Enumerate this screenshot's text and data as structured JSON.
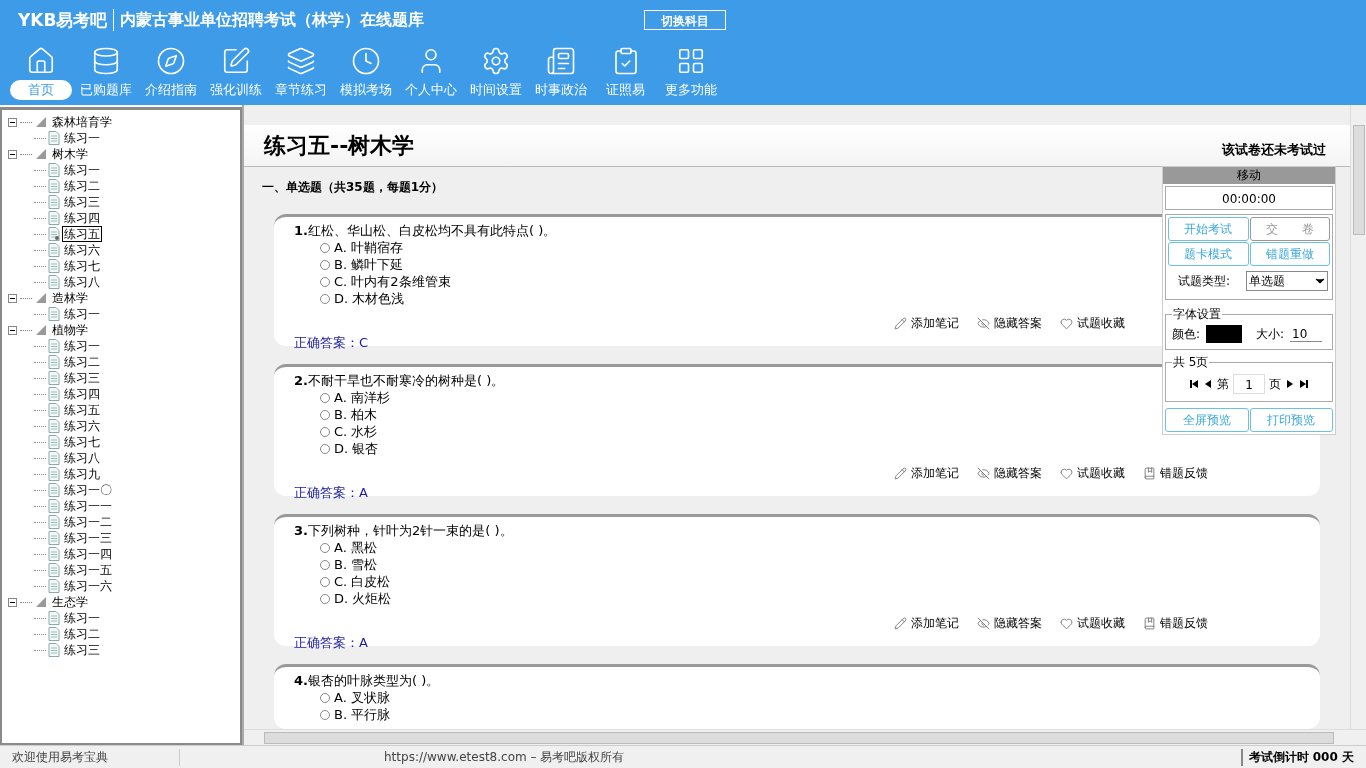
{
  "header": {
    "logo": "YKB易考吧",
    "title": "内蒙古事业单位招聘考试（林学）在线题库",
    "switch_button": "切换科目"
  },
  "nav": [
    {
      "label": "首页",
      "selected": true
    },
    {
      "label": "已购题库",
      "selected": false
    },
    {
      "label": "介绍指南",
      "selected": false
    },
    {
      "label": "强化训练",
      "selected": false
    },
    {
      "label": "章节练习",
      "selected": false
    },
    {
      "label": "模拟考场",
      "selected": false
    },
    {
      "label": "个人中心",
      "selected": false
    },
    {
      "label": "时间设置",
      "selected": false
    },
    {
      "label": "时事政治",
      "selected": false
    },
    {
      "label": "证照易",
      "selected": false
    },
    {
      "label": "更多功能",
      "selected": false
    }
  ],
  "tree": [
    {
      "label": "森林培育学",
      "expanded": true,
      "children": [
        {
          "label": "练习一",
          "selected": false
        }
      ]
    },
    {
      "label": "树木学",
      "expanded": true,
      "children": [
        {
          "label": "练习一",
          "selected": false
        },
        {
          "label": "练习二",
          "selected": false
        },
        {
          "label": "练习三",
          "selected": false
        },
        {
          "label": "练习四",
          "selected": false
        },
        {
          "label": "练习五",
          "selected": true
        },
        {
          "label": "练习六",
          "selected": false
        },
        {
          "label": "练习七",
          "selected": false
        },
        {
          "label": "练习八",
          "selected": false
        }
      ]
    },
    {
      "label": "造林学",
      "expanded": true,
      "children": [
        {
          "label": "练习一",
          "selected": false
        }
      ]
    },
    {
      "label": "植物学",
      "expanded": true,
      "children": [
        {
          "label": "练习一",
          "selected": false
        },
        {
          "label": "练习二",
          "selected": false
        },
        {
          "label": "练习三",
          "selected": false
        },
        {
          "label": "练习四",
          "selected": false
        },
        {
          "label": "练习五",
          "selected": false
        },
        {
          "label": "练习六",
          "selected": false
        },
        {
          "label": "练习七",
          "selected": false
        },
        {
          "label": "练习八",
          "selected": false
        },
        {
          "label": "练习九",
          "selected": false
        },
        {
          "label": "练习一〇",
          "selected": false
        },
        {
          "label": "练习一一",
          "selected": false
        },
        {
          "label": "练习一二",
          "selected": false
        },
        {
          "label": "练习一三",
          "selected": false
        },
        {
          "label": "练习一四",
          "selected": false
        },
        {
          "label": "练习一五",
          "selected": false
        },
        {
          "label": "练习一六",
          "selected": false
        }
      ]
    },
    {
      "label": "生态学",
      "expanded": true,
      "children": [
        {
          "label": "练习一",
          "selected": false
        },
        {
          "label": "练习二",
          "selected": false
        },
        {
          "label": "练习三",
          "selected": false
        }
      ]
    }
  ],
  "exam": {
    "title": "练习五--树木学",
    "status": "该试卷还未考试过",
    "section": "一、单选题（共35题，每题1分）",
    "questions": [
      {
        "number": "1.",
        "text": "红松、华山松、白皮松均不具有此特点(  )。",
        "options": [
          {
            "label": "A.",
            "text": "叶鞘宿存",
            "selected": false
          },
          {
            "label": "B.",
            "text": "鳞叶下延",
            "selected": false
          },
          {
            "label": "C.",
            "text": "叶内有2条维管束",
            "selected": false
          },
          {
            "label": "D.",
            "text": "木材色浅",
            "selected": false
          }
        ],
        "actions": [
          "添加笔记",
          "隐藏答案",
          "试题收藏"
        ],
        "answer_label": "正确答案：",
        "answer": "C"
      },
      {
        "number": "2.",
        "text": "不耐干旱也不耐寒冷的树种是(  )。",
        "options": [
          {
            "label": "A.",
            "text": "南洋杉",
            "selected": false
          },
          {
            "label": "B.",
            "text": "柏木",
            "selected": false
          },
          {
            "label": "C.",
            "text": "水杉",
            "selected": false
          },
          {
            "label": "D.",
            "text": "银杏",
            "selected": false
          }
        ],
        "actions": [
          "添加笔记",
          "隐藏答案",
          "试题收藏",
          "错题反馈"
        ],
        "answer_label": "正确答案：",
        "answer": "A"
      },
      {
        "number": "3.",
        "text": "下列树种，针叶为2针一束的是(  )。",
        "options": [
          {
            "label": "A.",
            "text": "黑松",
            "selected": false
          },
          {
            "label": "B.",
            "text": "雪松",
            "selected": false
          },
          {
            "label": "C.",
            "text": "白皮松",
            "selected": false
          },
          {
            "label": "D.",
            "text": "火炬松",
            "selected": false
          }
        ],
        "actions": [
          "添加笔记",
          "隐藏答案",
          "试题收藏",
          "错题反馈"
        ],
        "answer_label": "正确答案：",
        "answer": "A"
      },
      {
        "number": "4.",
        "text": "银杏的叶脉类型为(  )。",
        "options": [
          {
            "label": "A.",
            "text": "叉状脉",
            "selected": false
          },
          {
            "label": "B.",
            "text": "平行脉",
            "selected": false
          }
        ]
      }
    ]
  },
  "panel": {
    "move_label": "移动",
    "timer": "00:00:00",
    "buttons": [
      {
        "label": "开始考试",
        "disabled": false
      },
      {
        "label": "交　　卷",
        "disabled": true
      },
      {
        "label": "题卡模式",
        "disabled": false
      },
      {
        "label": "错题重做",
        "disabled": false
      }
    ],
    "type_label": "试题类型:",
    "type_value": "单选题",
    "font_legend": "字体设置",
    "color_label": "颜色:",
    "size_label": "大小:",
    "size_value": "10",
    "pager_legend": "共 5页",
    "page_prefix": "第",
    "page_value": "1",
    "page_suffix": "页",
    "bottom_buttons": [
      "全屏预览",
      "打印预览"
    ]
  },
  "status_bar": {
    "welcome": "欢迎使用易考宝典",
    "copyright": "https://www.etest8.com – 易考吧版权所有",
    "countdown": "考试倒计时 000 天"
  }
}
